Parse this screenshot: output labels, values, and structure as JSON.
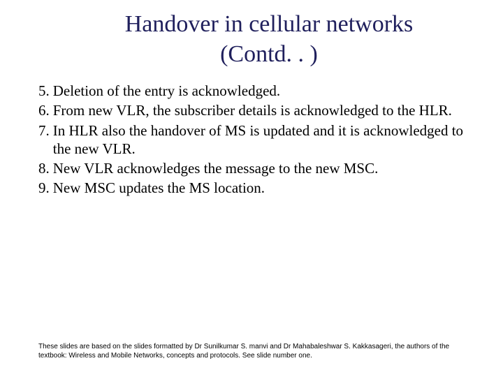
{
  "title_line1": "Handover in cellular networks",
  "title_line2": "(Contd. . )",
  "items": [
    {
      "n": "5.",
      "t": "Deletion of the entry is acknowledged."
    },
    {
      "n": "6.",
      "t": "From new VLR, the subscriber details is acknowledged to the HLR."
    },
    {
      "n": "7.",
      "t": "In HLR also the handover of MS is updated and it is acknowledged to the new VLR."
    },
    {
      "n": "8.",
      "t": "New VLR acknowledges the message to the new MSC."
    },
    {
      "n": "9.",
      "t": "New MSC updates the MS location."
    }
  ],
  "footnote": "These slides are based on the slides formatted by Dr Sunilkumar S. manvi and Dr Mahabaleshwar S. Kakkasageri, the authors of the textbook: Wireless and Mobile Networks, concepts and protocols. See slide number one."
}
